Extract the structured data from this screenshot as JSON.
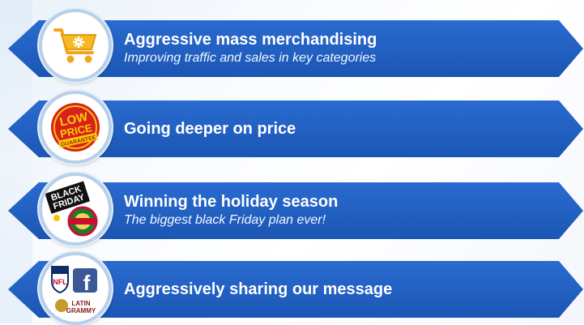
{
  "colors": {
    "banner_blue": "#1f5fc4",
    "banner_blue_dark": "#1a52ab",
    "text_white": "#ffffff",
    "badge_ring": "#b7d0ea"
  },
  "items": [
    {
      "title": "Aggressive mass merchandising",
      "subtitle": "Improving traffic and sales in key categories",
      "icon": "shopping-cart-icon"
    },
    {
      "title": "Going deeper on price",
      "subtitle": "",
      "icon": "low-price-guarantee-icon",
      "badge_text": [
        "LOW",
        "PRICE",
        "GUARANTEE"
      ]
    },
    {
      "title": "Winning the holiday season",
      "subtitle": "The biggest black Friday plan ever!",
      "icon": "black-friday-icon",
      "badge_text": [
        "BLACK",
        "FRIDAY"
      ]
    },
    {
      "title": "Aggressively sharing our message",
      "subtitle": "",
      "icon": "nfl-facebook-latin-grammy-icon",
      "badge_text": [
        "NFL",
        "f",
        "LATIN",
        "GRAMMY"
      ]
    }
  ]
}
